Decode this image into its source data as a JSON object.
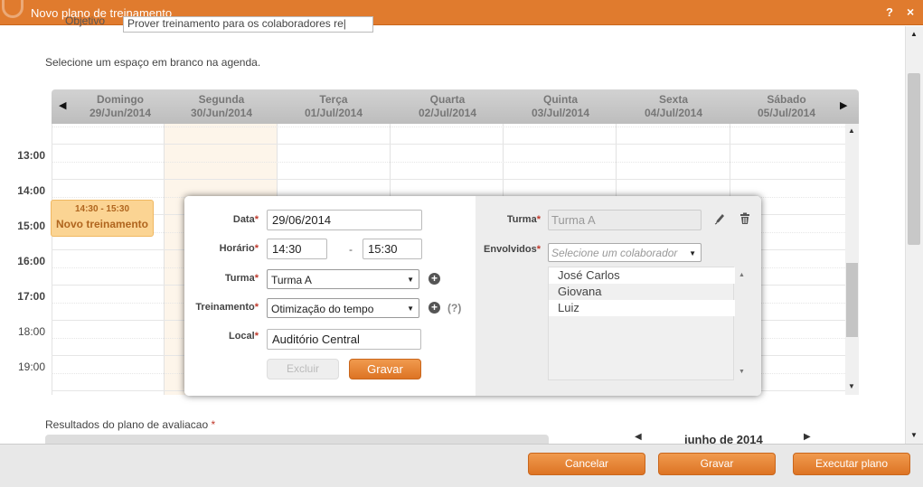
{
  "window": {
    "title": "Novo plano de treinamento",
    "help_label": "?",
    "close_label": "×"
  },
  "objective": {
    "label": "Objetivo",
    "value": "Prover treinamento para os colaboradores re|"
  },
  "instructions": "Selecione um espaço em branco na agenda.",
  "calendar": {
    "prev_label": "◀",
    "next_label": "▶",
    "days": [
      {
        "name": "Domingo",
        "date": "29/Jun/2014"
      },
      {
        "name": "Segunda",
        "date": "30/Jun/2014"
      },
      {
        "name": "Terça",
        "date": "01/Jul/2014"
      },
      {
        "name": "Quarta",
        "date": "02/Jul/2014"
      },
      {
        "name": "Quinta",
        "date": "03/Jul/2014"
      },
      {
        "name": "Sexta",
        "date": "04/Jul/2014"
      },
      {
        "name": "Sábado",
        "date": "05/Jul/2014"
      }
    ],
    "times": [
      "13:00",
      "14:00",
      "15:00",
      "16:00",
      "17:00",
      "18:00",
      "19:00"
    ],
    "event": {
      "time": "14:30 - 15:30",
      "name": "Novo treinamento"
    }
  },
  "dialog": {
    "left": {
      "date_label": "Data",
      "date_value": "29/06/2014",
      "time_label": "Horário",
      "time_start": "14:30",
      "time_sep": "-",
      "time_end": "15:30",
      "class_label": "Turma",
      "class_value": "Turma A",
      "training_label": "Treinamento",
      "training_value": "Otimização do tempo",
      "help_label": "(?)",
      "place_label": "Local",
      "place_value": "Auditório Central",
      "delete_button": "Excluir",
      "save_button": "Gravar"
    },
    "right": {
      "class_label": "Turma",
      "class_value": "Turma A",
      "involved_label": "Envolvidos",
      "involved_placeholder": "Selecione um colaborador",
      "people": [
        "José Carlos",
        "Giovana",
        "Luiz"
      ]
    },
    "required_mark": "*"
  },
  "results": {
    "label": "Resultados do plano de avaliacao",
    "required_mark": "*"
  },
  "mini_calendar": {
    "title": "junho de 2014",
    "prev_label": "◀",
    "next_label": "▶"
  },
  "footer": {
    "cancel_label": "Cancelar",
    "save_label": "Gravar",
    "execute_label": "Executar plano"
  },
  "colors": {
    "accent": "#e07b2e",
    "event_bg": "#fbd493",
    "highlight_column": "#fdf5ea"
  }
}
